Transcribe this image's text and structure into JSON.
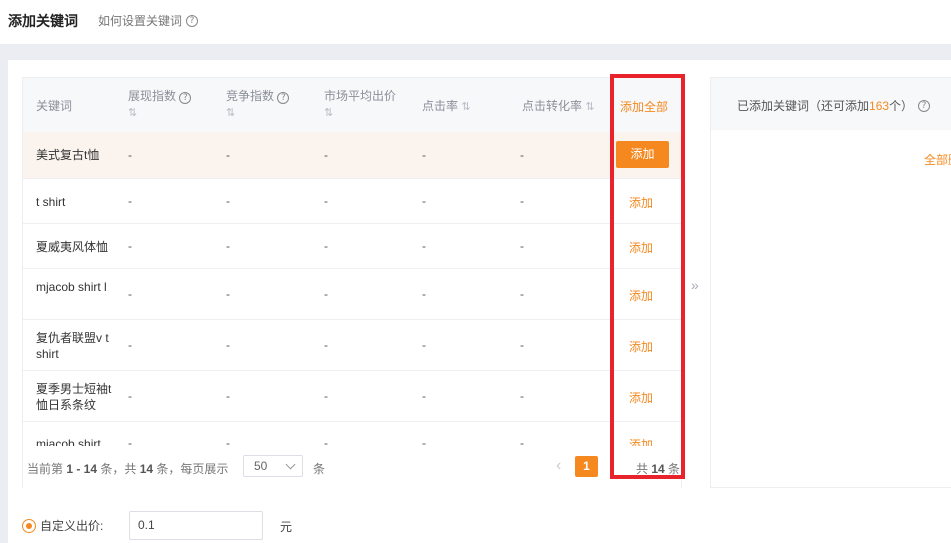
{
  "header": {
    "title": "添加关键词",
    "help_link": "如何设置关键词"
  },
  "table": {
    "columns": {
      "keyword": "关键词",
      "impression_index": "展现指数",
      "competition_index": "竞争指数",
      "avg_price": "市场平均出价",
      "ctr": "点击率",
      "cvr": "点击转化率",
      "add_all": "添加全部"
    },
    "sort_glyph": "⇅",
    "rows": [
      {
        "keyword": "美式复古t恤",
        "impression": "-",
        "competition": "-",
        "avg_price": "-",
        "ctr": "-",
        "cvr": "-",
        "action": "添加"
      },
      {
        "keyword": "t shirt",
        "impression": "-",
        "competition": "-",
        "avg_price": "-",
        "ctr": "-",
        "cvr": "-",
        "action": "添加"
      },
      {
        "keyword": "夏威夷风体恤",
        "impression": "-",
        "competition": "-",
        "avg_price": "-",
        "ctr": "-",
        "cvr": "-",
        "action": "添加"
      },
      {
        "keyword": "mjacob shirt l",
        "impression": "-",
        "competition": "-",
        "avg_price": "-",
        "ctr": "-",
        "cvr": "-",
        "action": "添加"
      },
      {
        "keyword": "复仇者联盟v t shirt",
        "impression": "-",
        "competition": "-",
        "avg_price": "-",
        "ctr": "-",
        "cvr": "-",
        "action": "添加"
      },
      {
        "keyword": "夏季男士短袖t恤日系条纹",
        "impression": "-",
        "competition": "-",
        "avg_price": "-",
        "ctr": "-",
        "cvr": "-",
        "action": "添加"
      },
      {
        "keyword": "mjacob shirt",
        "impression": "-",
        "competition": "-",
        "avg_price": "-",
        "ctr": "-",
        "cvr": "-",
        "action": "添加"
      }
    ]
  },
  "pagination": {
    "prefix": "当前第 ",
    "range": "1 - 14",
    "mid1": " 条，共 ",
    "count": "14",
    "mid2": " 条，每页展示",
    "page_size": "50",
    "unit": "条",
    "prev_glyph": "‹",
    "current_page": "1",
    "total_prefix": "共 ",
    "total_count": "14",
    "total_suffix": " 条"
  },
  "transfer_arrow": "»",
  "added_panel": {
    "title_prefix": "已添加关键词（还可添加",
    "remaining": "163",
    "title_suffix": "个）",
    "action": "全部删除"
  },
  "bid": {
    "label": "自定义出价:",
    "value": "0.1",
    "unit": "元"
  },
  "colors": {
    "accent": "#f5891f",
    "annotation_box": "#e8232b",
    "highlight_row": "#fbf3ee"
  }
}
